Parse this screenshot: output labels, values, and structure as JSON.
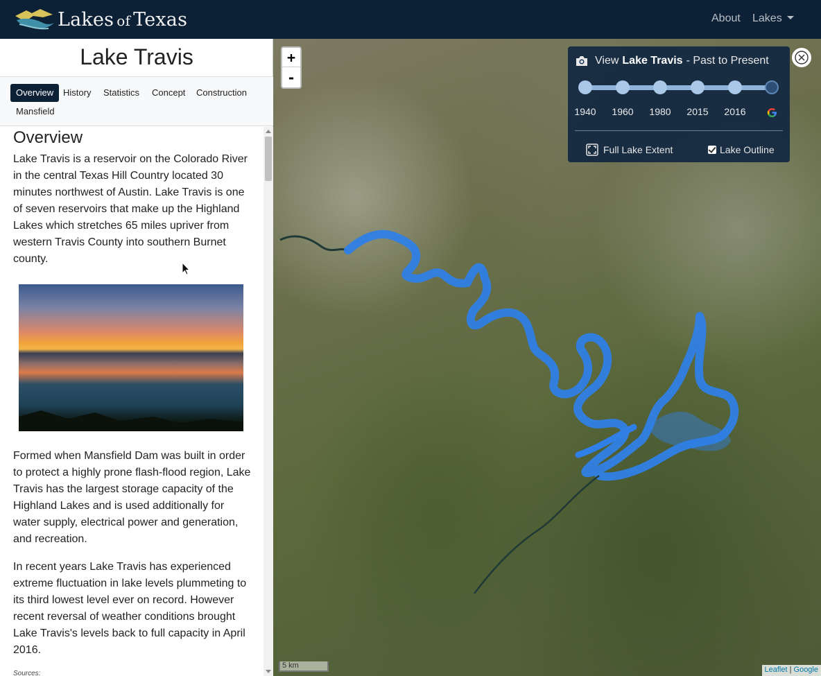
{
  "navbar": {
    "brand_main": "Lakes",
    "brand_of": "of",
    "brand_end": "Texas",
    "links": {
      "about": "About",
      "lakes": "Lakes"
    }
  },
  "sidebar": {
    "lake_title": "Lake Travis",
    "tabs": [
      "Overview",
      "History",
      "Statistics",
      "Concept",
      "Construction",
      "Mansfield"
    ],
    "active_tab": "Overview",
    "section_heading": "Overview",
    "paragraphs": [
      "Lake Travis is a reservoir on the Colorado River in the central Texas Hill Country located 30 minutes northwest of Austin. Lake Travis is one of seven reservoirs that make up the Highland Lakes which stretches 65 miles upriver from western Travis County into southern Burnet county.",
      "Formed when Mansfield Dam was built in order to protect a highly prone flash-flood region, Lake Travis has the largest storage capacity of the Highland Lakes and is used additionally for water supply, electrical power and generation, and recreation.",
      "In recent years Lake Travis has experienced extreme fluctuation in lake levels plummeting to its third lowest level ever on record. However recent reversal of weather conditions brought Lake Travis's levels back to full capacity in April 2016."
    ],
    "sources_label": "Sources:"
  },
  "map": {
    "zoom_in": "+",
    "zoom_out": "-",
    "panel": {
      "prefix": "View",
      "lake_name": "Lake Travis",
      "suffix": "- Past to Present",
      "years": [
        "1940",
        "1960",
        "1980",
        "2015",
        "2016"
      ],
      "selected": "Google",
      "full_extent_label": "Full Lake Extent",
      "outline_label": "Lake Outline",
      "outline_checked": true
    },
    "scale_label": "5 km",
    "attribution": {
      "leaflet": "Leaflet",
      "separator": "|",
      "google": "Google"
    },
    "lake_color": "#2f7fe6"
  },
  "colors": {
    "navbar_bg": "#0c2036",
    "active_tab_bg": "#0c2036",
    "panel_bg": "#102640"
  }
}
